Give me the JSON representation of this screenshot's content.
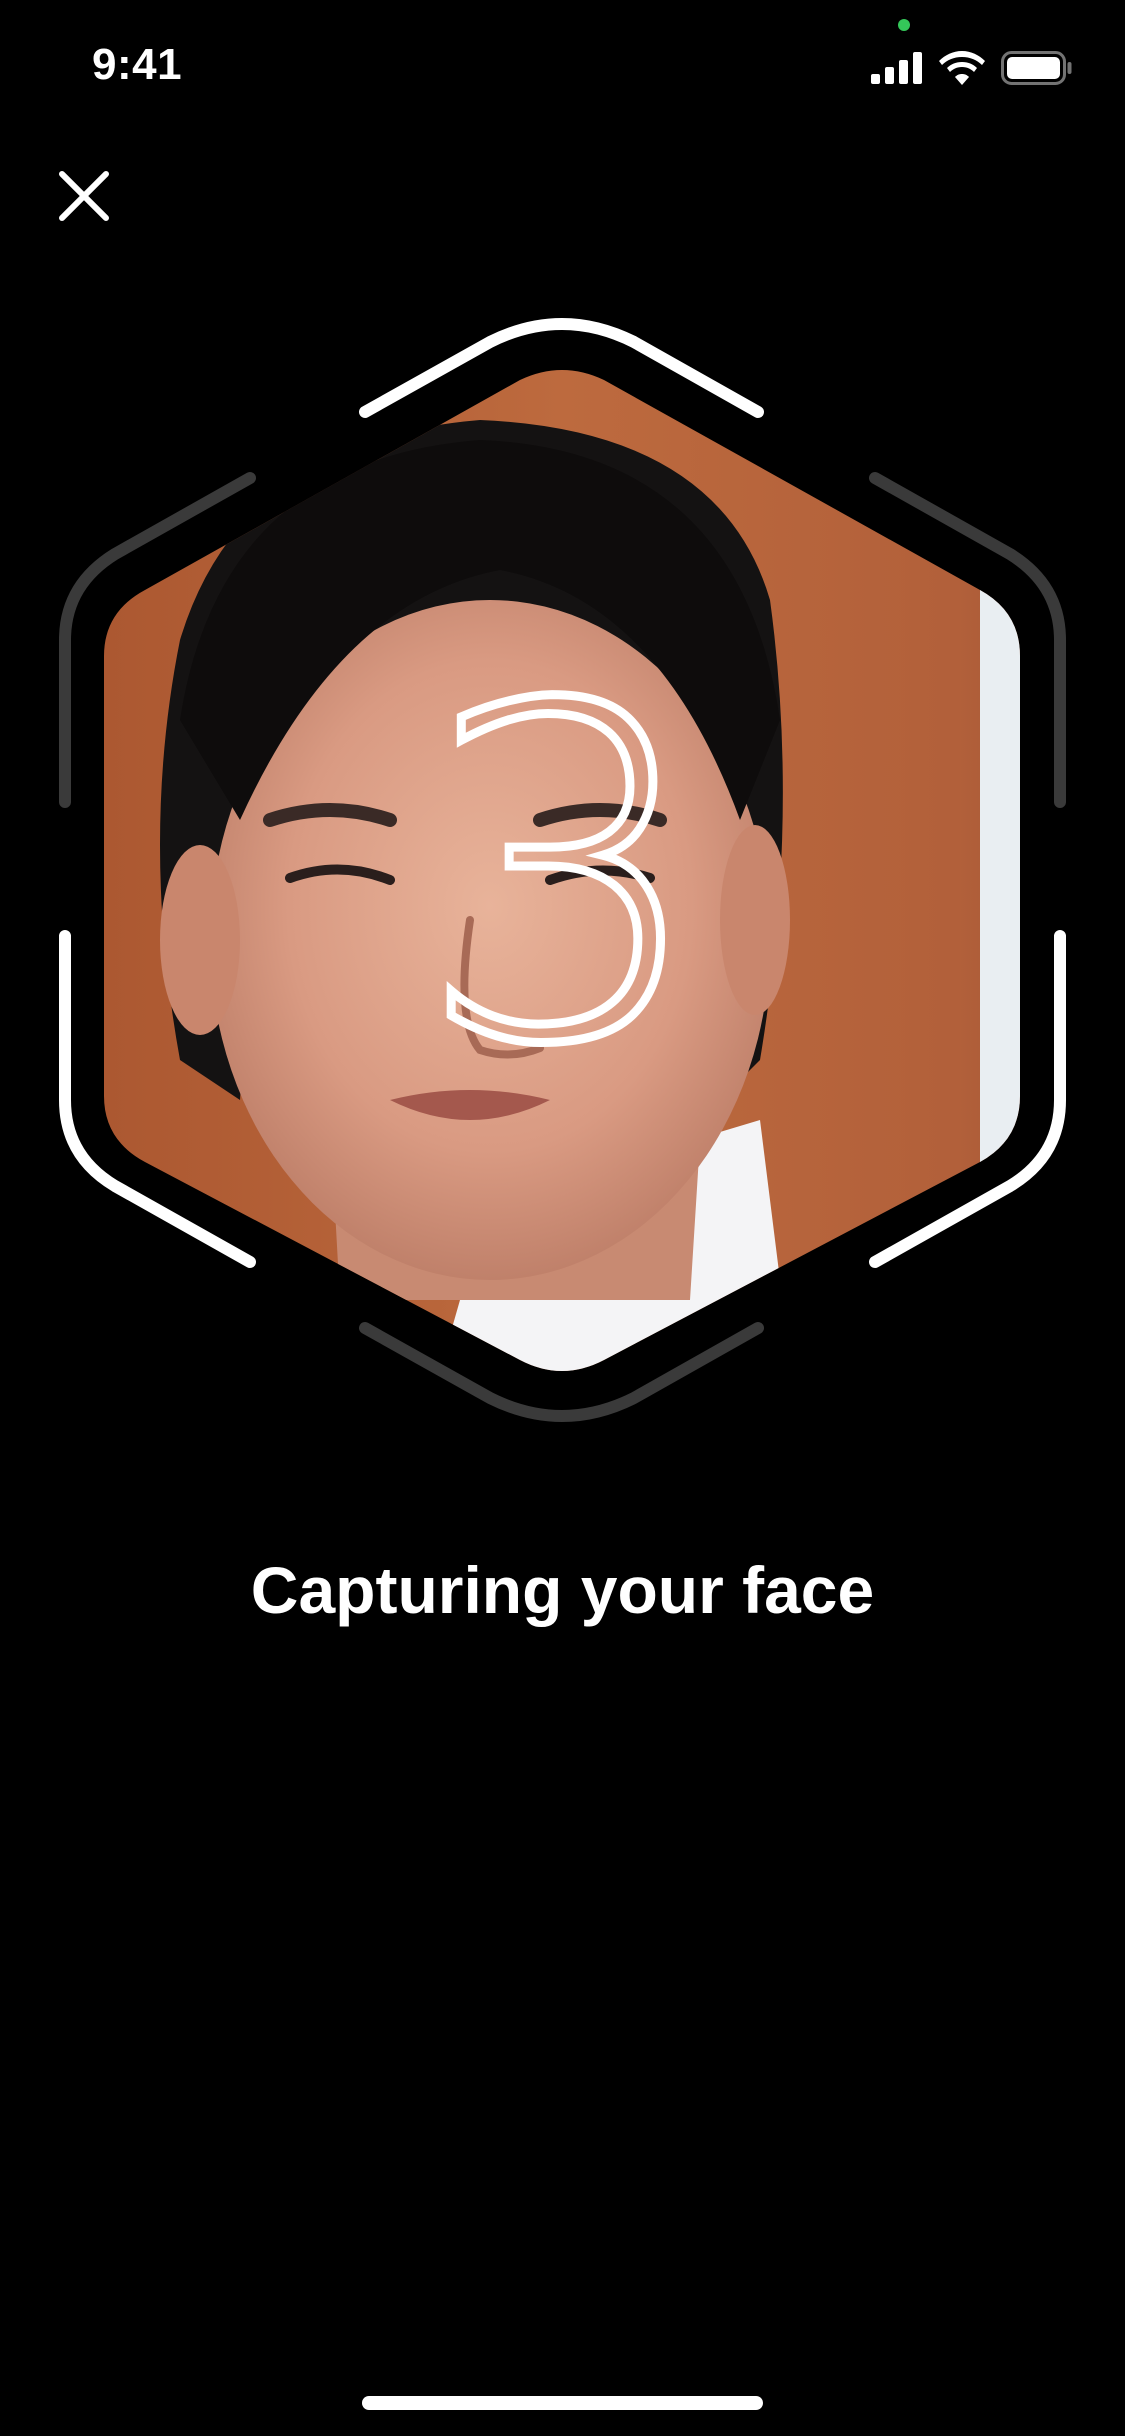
{
  "status_bar": {
    "time": "9:41",
    "signal_icon": "cellular-signal-icon",
    "wifi_icon": "wifi-icon",
    "battery_icon": "battery-icon",
    "camera_indicator_color": "#34c759"
  },
  "close_button": {
    "icon": "close-icon"
  },
  "capture": {
    "countdown": "3",
    "frame_active_color": "#ffffff",
    "frame_inactive_color": "#3a3a3a"
  },
  "caption": "Capturing your face"
}
